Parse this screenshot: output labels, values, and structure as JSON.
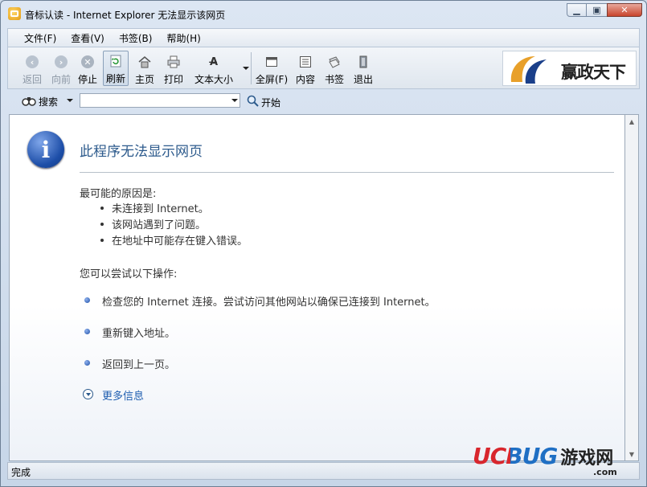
{
  "window": {
    "title": "音标认读 - Internet Explorer 无法显示该网页"
  },
  "menu": [
    "文件(F)",
    "查看(V)",
    "书签(B)",
    "帮助(H)"
  ],
  "toolbar": {
    "back": "返回",
    "forward": "向前",
    "stop": "停止",
    "refresh": "刷新",
    "home": "主页",
    "print": "打印",
    "textsize": "文本大小",
    "fullscreen": "全屏(F)",
    "contents": "内容",
    "bookmarks": "书签",
    "exit": "退出"
  },
  "logo": {
    "text": "赢政天下"
  },
  "search": {
    "label": "搜索",
    "value": "",
    "go": "开始"
  },
  "error": {
    "heading": "此程序无法显示网页",
    "causes_title": "最可能的原因是:",
    "causes": [
      "未连接到 Internet。",
      "该网站遇到了问题。",
      "在地址中可能存在键入错误。"
    ],
    "actions_title": "您可以尝试以下操作:",
    "actions": [
      "检查您的 Internet 连接。尝试访问其他网站以确保已连接到 Internet。",
      "重新键入地址。",
      "返回到上一页。"
    ],
    "more": "更多信息"
  },
  "status": {
    "text": "完成"
  },
  "watermark": {
    "brand": "UCBUG",
    "cn": "游戏网",
    "domain": ".com"
  },
  "colors": {
    "heading": "#2c5a8c",
    "link": "#1f5eb0",
    "wm_red": "#d8262d",
    "wm_blue": "#1f6fc4"
  }
}
